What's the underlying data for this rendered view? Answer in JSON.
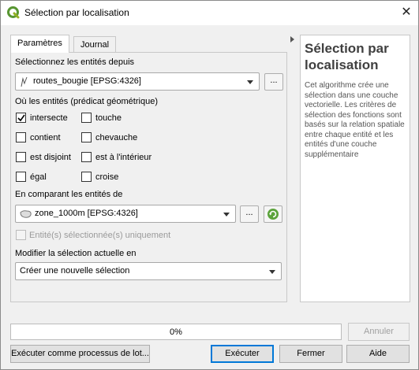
{
  "window": {
    "title": "Sélection par localisation",
    "close_symbol": "✕"
  },
  "tabs": {
    "parameters": "Paramètres",
    "log": "Journal"
  },
  "form": {
    "select_from_label": "Sélectionnez les entités depuis",
    "source_layer": "routes_bougie [EPSG:4326]",
    "where_label": "Où les entités (prédicat géométrique)",
    "predicates": [
      {
        "label": "intersecte",
        "checked": true
      },
      {
        "label": "touche",
        "checked": false
      },
      {
        "label": "contient",
        "checked": false
      },
      {
        "label": "chevauche",
        "checked": false
      },
      {
        "label": "est disjoint",
        "checked": false
      },
      {
        "label": "est à l'intérieur",
        "checked": false
      },
      {
        "label": "égal",
        "checked": false
      },
      {
        "label": "croise",
        "checked": false
      }
    ],
    "compare_label": "En comparant les entités de",
    "compare_layer": "zone_1000m [EPSG:4326]",
    "selected_only_label": "Entité(s) sélectionnée(s) uniquement",
    "modify_label": "Modifier la sélection actuelle en",
    "modify_value": "Créer une nouvelle sélection",
    "dots": "..."
  },
  "help": {
    "title": "Sélection par localisation",
    "body": "Cet algorithme crée une sélection dans une couche vectorielle. Les critères de sélection des fonctions sont basés sur la relation spatiale entre chaque entité et les entités d'une couche supplémentaire"
  },
  "progress": {
    "text": "0%",
    "value": 0
  },
  "buttons": {
    "cancel": "Annuler",
    "batch": "Exécuter comme processus de lot...",
    "run": "Exécuter",
    "close": "Fermer",
    "help": "Aide"
  }
}
